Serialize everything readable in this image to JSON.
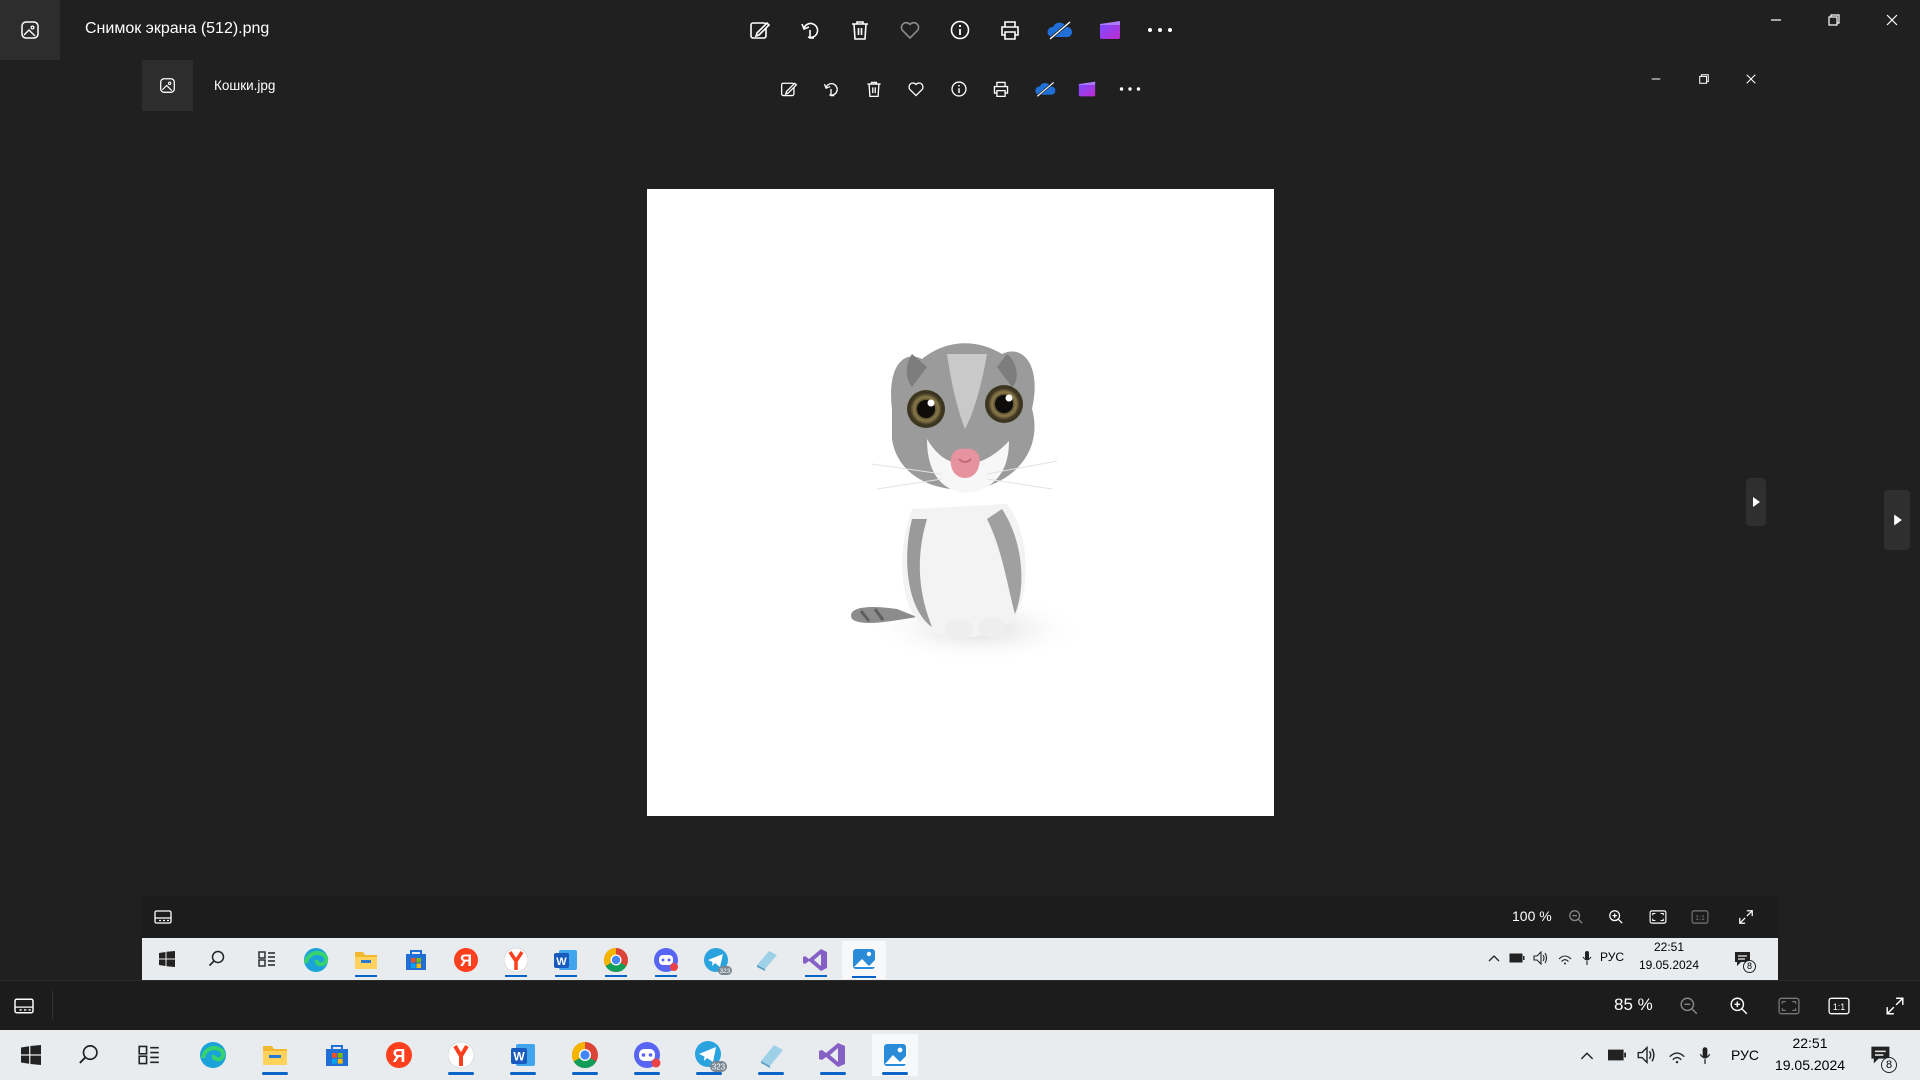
{
  "window": {
    "title": "Снимок экрана (512).png"
  },
  "toolbar": {
    "icons": [
      "edit-image-icon",
      "rotate-icon",
      "delete-icon",
      "favorite-icon",
      "info-icon",
      "print-icon",
      "onedrive-icon",
      "clipchamp-icon",
      "more-icon"
    ]
  },
  "inner_window": {
    "title": "Кошки.jpg",
    "zoom": "100 %",
    "taskbar": {
      "language": "РУС",
      "time": "22:51",
      "date": "19.05.2024",
      "notifications": "8",
      "telegram_badge": "323"
    }
  },
  "bottom_bar": {
    "zoom": "85 %"
  },
  "taskbar": {
    "language": "РУС",
    "time": "22:51",
    "date": "19.05.2024",
    "notifications": "8",
    "telegram_badge": "323",
    "apps": [
      "start",
      "search",
      "task-view",
      "edge",
      "file-explorer",
      "microsoft-store",
      "yandex",
      "yandex-browser",
      "word",
      "chrome",
      "discord",
      "telegram",
      "notepad",
      "visual-studio",
      "photos"
    ]
  },
  "colors": {
    "background": "#202020",
    "taskbar": "#e9ecef",
    "accent_underline": "#0a64c8"
  }
}
